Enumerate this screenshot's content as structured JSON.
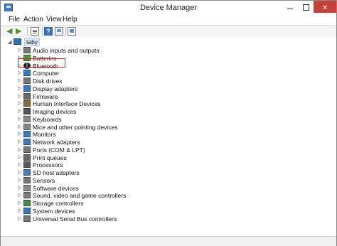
{
  "window": {
    "title": "Device Manager"
  },
  "menu": [
    "File",
    "Action",
    "View",
    "Help"
  ],
  "toolbar": {
    "icons": [
      "back-arrow-icon",
      "forward-arrow-icon",
      "properties-icon",
      "help-icon",
      "scan-hardware-icon",
      "monitor-icon"
    ]
  },
  "tree": {
    "root": "taby",
    "items": [
      {
        "label": "Audio inputs and outputs",
        "icon": "audio-icon",
        "color": "#7a7a7a"
      },
      {
        "label": "Batteries",
        "icon": "battery-icon",
        "color": "#4a9a3a"
      },
      {
        "label": "Bluetooth",
        "icon": "bluetooth-icon",
        "color": "#1f1f1f"
      },
      {
        "label": "Computer",
        "icon": "computer-icon",
        "color": "#3a78c2"
      },
      {
        "label": "Disk drives",
        "icon": "disk-icon",
        "color": "#777777"
      },
      {
        "label": "Display adapters",
        "icon": "display-adapter-icon",
        "color": "#3a78c2"
      },
      {
        "label": "Firmware",
        "icon": "firmware-icon",
        "color": "#6a6a6a"
      },
      {
        "label": "Human Interface Devices",
        "icon": "hid-icon",
        "color": "#8a6a3a"
      },
      {
        "label": "Imaging devices",
        "icon": "camera-icon",
        "color": "#555555"
      },
      {
        "label": "Keyboards",
        "icon": "keyboard-icon",
        "color": "#888888"
      },
      {
        "label": "Mice and other pointing devices",
        "icon": "mouse-icon",
        "color": "#888888"
      },
      {
        "label": "Monitors",
        "icon": "monitor-icon",
        "color": "#3a78c2"
      },
      {
        "label": "Network adapters",
        "icon": "network-icon",
        "color": "#3a78c2"
      },
      {
        "label": "Ports (COM & LPT)",
        "icon": "port-icon",
        "color": "#777777"
      },
      {
        "label": "Print queues",
        "icon": "printer-icon",
        "color": "#666666"
      },
      {
        "label": "Processors",
        "icon": "processor-icon",
        "color": "#5a5a5a"
      },
      {
        "label": "SD host adapters",
        "icon": "sd-card-icon",
        "color": "#4a7ab8"
      },
      {
        "label": "Sensors",
        "icon": "sensor-icon",
        "color": "#777777"
      },
      {
        "label": "Software devices",
        "icon": "software-device-icon",
        "color": "#888888"
      },
      {
        "label": "Sound, video and game controllers",
        "icon": "speaker-icon",
        "color": "#7a7a7a"
      },
      {
        "label": "Storage controllers",
        "icon": "storage-icon",
        "color": "#4a8a4a"
      },
      {
        "label": "System devices",
        "icon": "system-device-icon",
        "color": "#3a78c2"
      },
      {
        "label": "Universal Serial Bus controllers",
        "icon": "usb-icon",
        "color": "#777777"
      }
    ]
  },
  "highlight": {
    "item": "Bluetooth",
    "color": "#c2262e"
  }
}
